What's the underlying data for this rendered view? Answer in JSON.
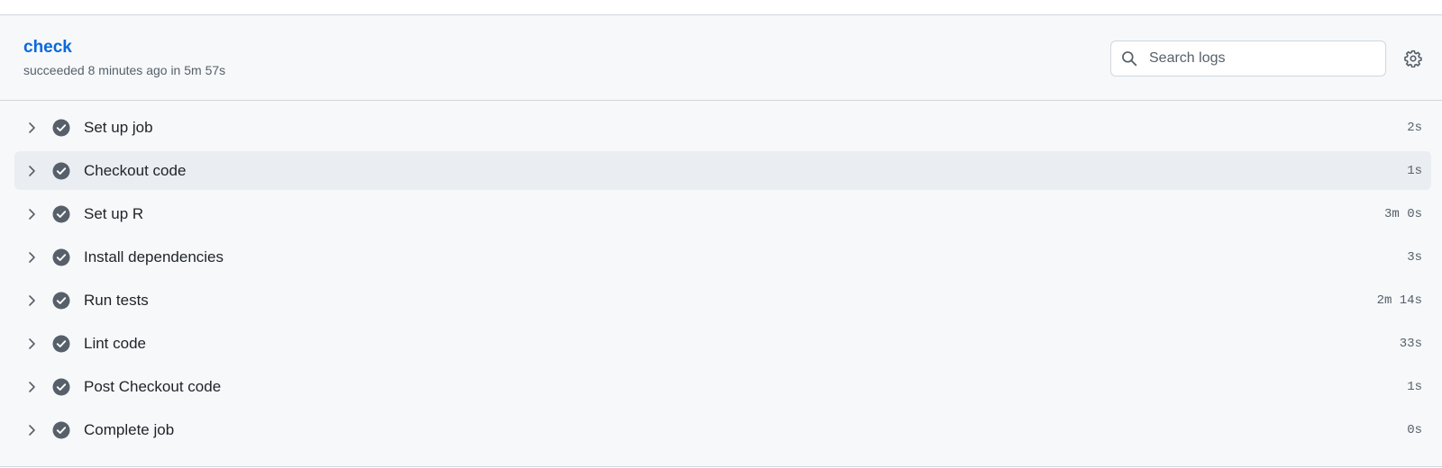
{
  "job": {
    "title": "check",
    "meta": "succeeded 8 minutes ago in 5m 57s"
  },
  "search": {
    "placeholder": "Search logs",
    "value": ""
  },
  "icons": {
    "search": "search-icon",
    "settings": "gear-icon",
    "expand": "chevron-right-icon",
    "status": "check-circle-icon"
  },
  "colors": {
    "link": "#0969da",
    "status_success_icon": "#57606a",
    "hover_row": "#eaeef2"
  },
  "steps": [
    {
      "name": "Set up job",
      "duration": "2s"
    },
    {
      "name": "Checkout code",
      "duration": "1s"
    },
    {
      "name": "Set up R",
      "duration": "3m 0s"
    },
    {
      "name": "Install dependencies",
      "duration": "3s"
    },
    {
      "name": "Run tests",
      "duration": "2m 14s"
    },
    {
      "name": "Lint code",
      "duration": "33s"
    },
    {
      "name": "Post Checkout code",
      "duration": "1s"
    },
    {
      "name": "Complete job",
      "duration": "0s"
    }
  ]
}
